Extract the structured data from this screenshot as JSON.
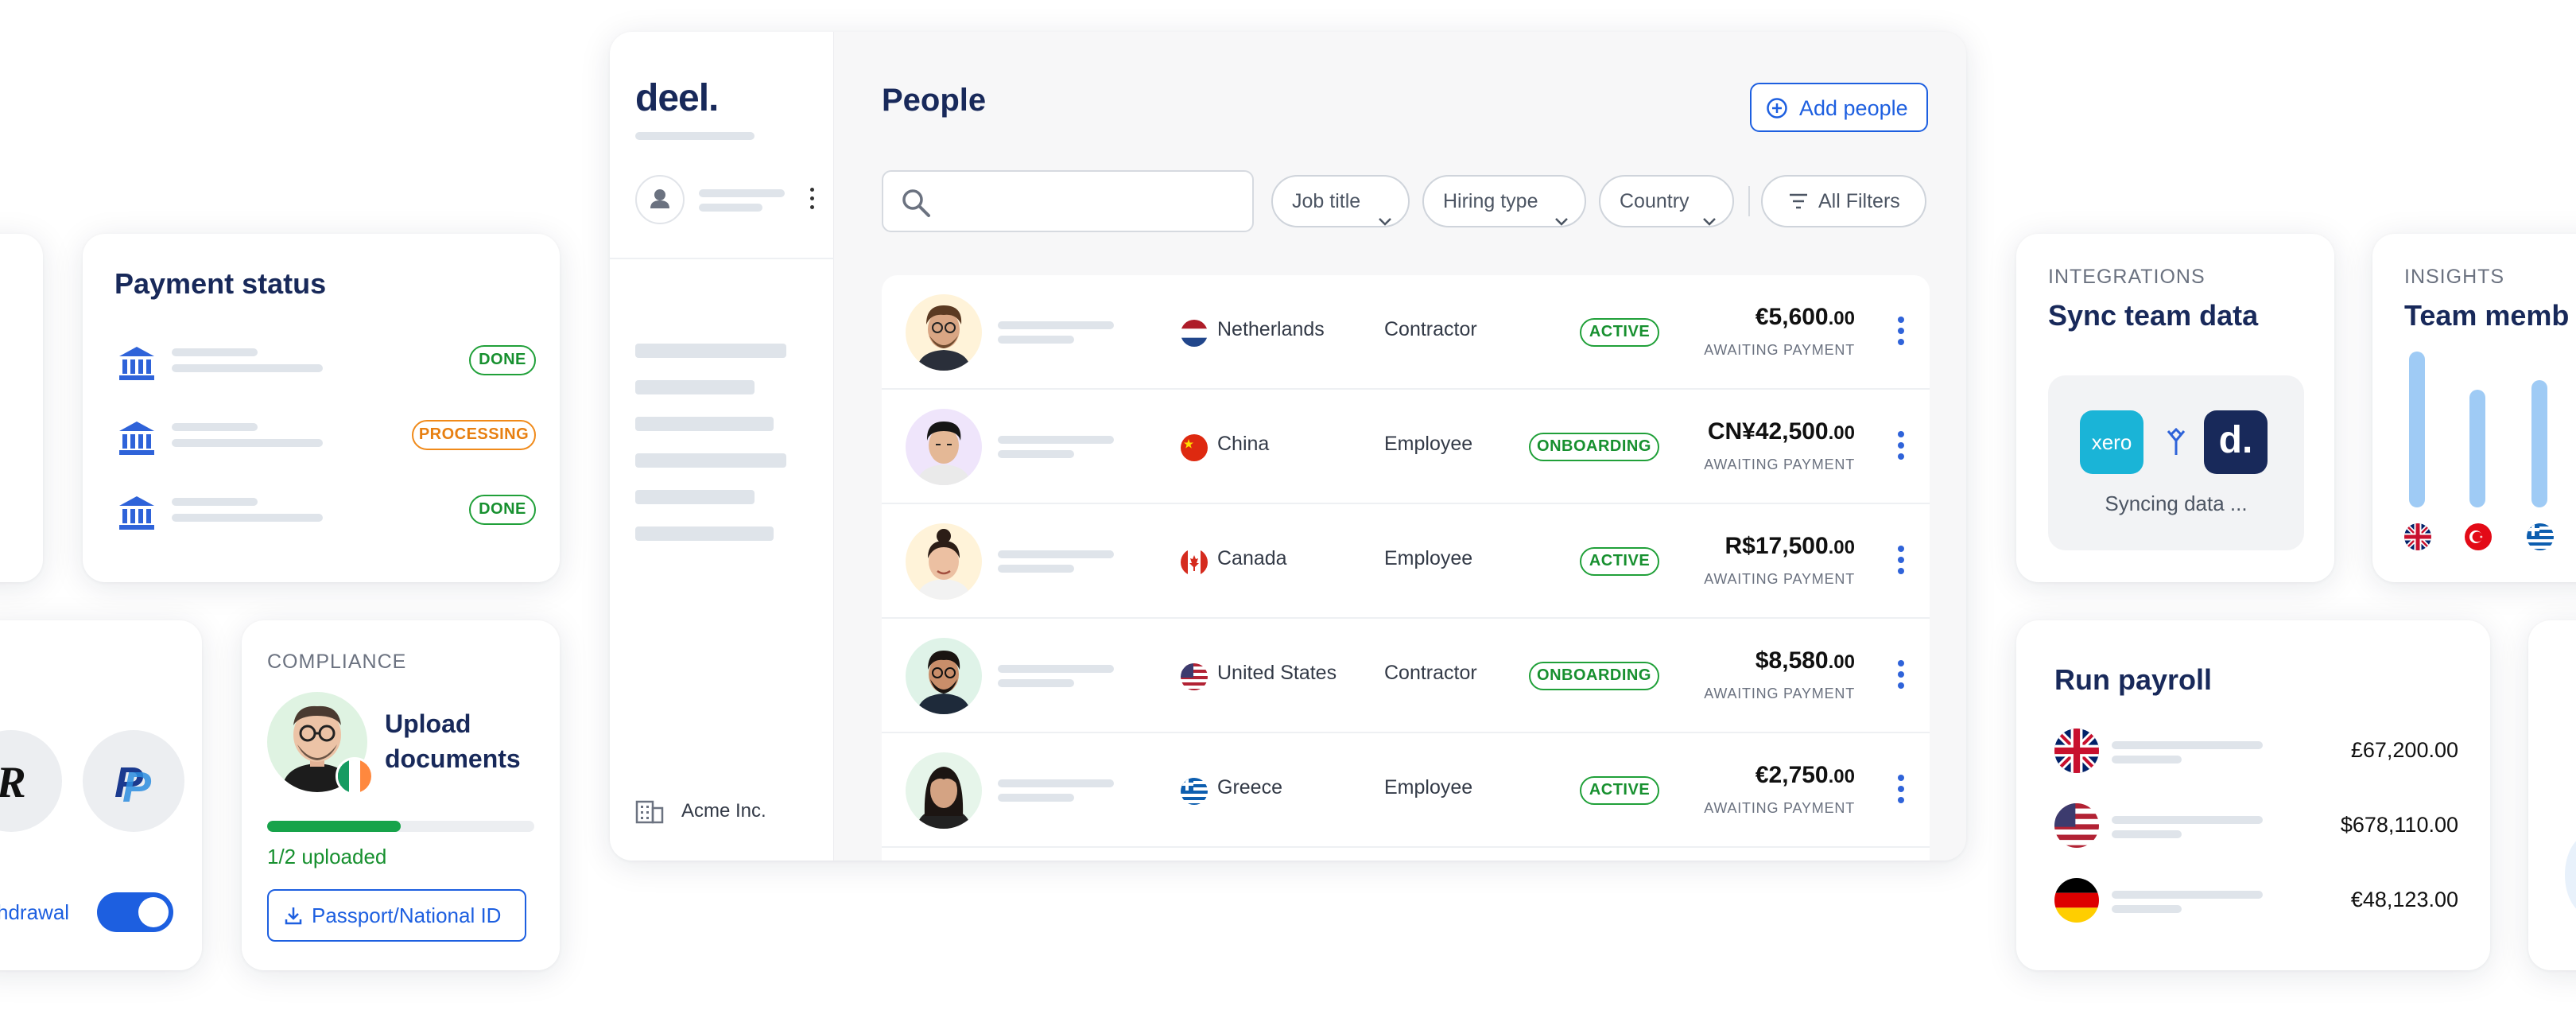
{
  "colors": {
    "navy": "#18295a",
    "accent_blue": "#1d5fe0",
    "success_green": "#17902f",
    "processing_orange": "#e77f10",
    "bar_blue": "#9fcbf5"
  },
  "app": {
    "brand": "deel.",
    "company": "Acme Inc.",
    "title": "People",
    "add_button": "Add people",
    "filters": {
      "job_title": "Job title",
      "hiring_type": "Hiring type",
      "country": "Country",
      "all_filters": "All Filters"
    },
    "rows": [
      {
        "country": "Netherlands",
        "hiring_type": "Contractor",
        "status": "ACTIVE",
        "amount": "€5,600",
        "cents": ".00",
        "payment_state": "AWAITING PAYMENT",
        "flag": "flag-netherlands"
      },
      {
        "country": "China",
        "hiring_type": "Employee",
        "status": "ONBOARDING",
        "amount": "CN¥42,500",
        "cents": ".00",
        "payment_state": "AWAITING PAYMENT",
        "flag": "flag-china"
      },
      {
        "country": "Canada",
        "hiring_type": "Employee",
        "status": "ACTIVE",
        "amount": "R$17,500",
        "cents": ".00",
        "payment_state": "AWAITING PAYMENT",
        "flag": "flag-canada"
      },
      {
        "country": "United States",
        "hiring_type": "Contractor",
        "status": "ONBOARDING",
        "amount": "$8,580",
        "cents": ".00",
        "payment_state": "AWAITING PAYMENT",
        "flag": "flag-united-states"
      },
      {
        "country": "Greece",
        "hiring_type": "Employee",
        "status": "ACTIVE",
        "amount": "€2,750",
        "cents": ".00",
        "payment_state": "AWAITING PAYMENT",
        "flag": "flag-greece"
      }
    ]
  },
  "payment_status": {
    "title": "Payment status",
    "items": [
      {
        "status": "DONE"
      },
      {
        "status": "PROCESSING"
      },
      {
        "status": "DONE"
      }
    ]
  },
  "withdrawal": {
    "label": "hdrawal",
    "toggle_on": true,
    "icons": [
      "revolut-icon",
      "paypal-icon"
    ]
  },
  "compliance": {
    "eyebrow": "COMPLIANCE",
    "heading_line1": "Upload",
    "heading_line2": "documents",
    "progress_text": "1/2 uploaded",
    "progress": 0.5,
    "button": "Passport/National ID"
  },
  "integrations": {
    "eyebrow": "INTEGRATIONS",
    "title": "Sync team data",
    "xero_label": "xero",
    "deel_label": "d.",
    "status": "Syncing data ..."
  },
  "insights": {
    "eyebrow": "INSIGHTS",
    "title": "Team memb",
    "bars": [
      0.98,
      0.74,
      0.8
    ],
    "flags": [
      "flag-united-kingdom",
      "flag-turkey",
      "flag-greece"
    ]
  },
  "payroll": {
    "title": "Run payroll",
    "items": [
      {
        "flag": "flag-united-kingdom",
        "amount": "£67,200.00"
      },
      {
        "flag": "flag-united-states",
        "amount": "$678,110.00"
      },
      {
        "flag": "flag-germany",
        "amount": "€48,123.00"
      }
    ]
  }
}
